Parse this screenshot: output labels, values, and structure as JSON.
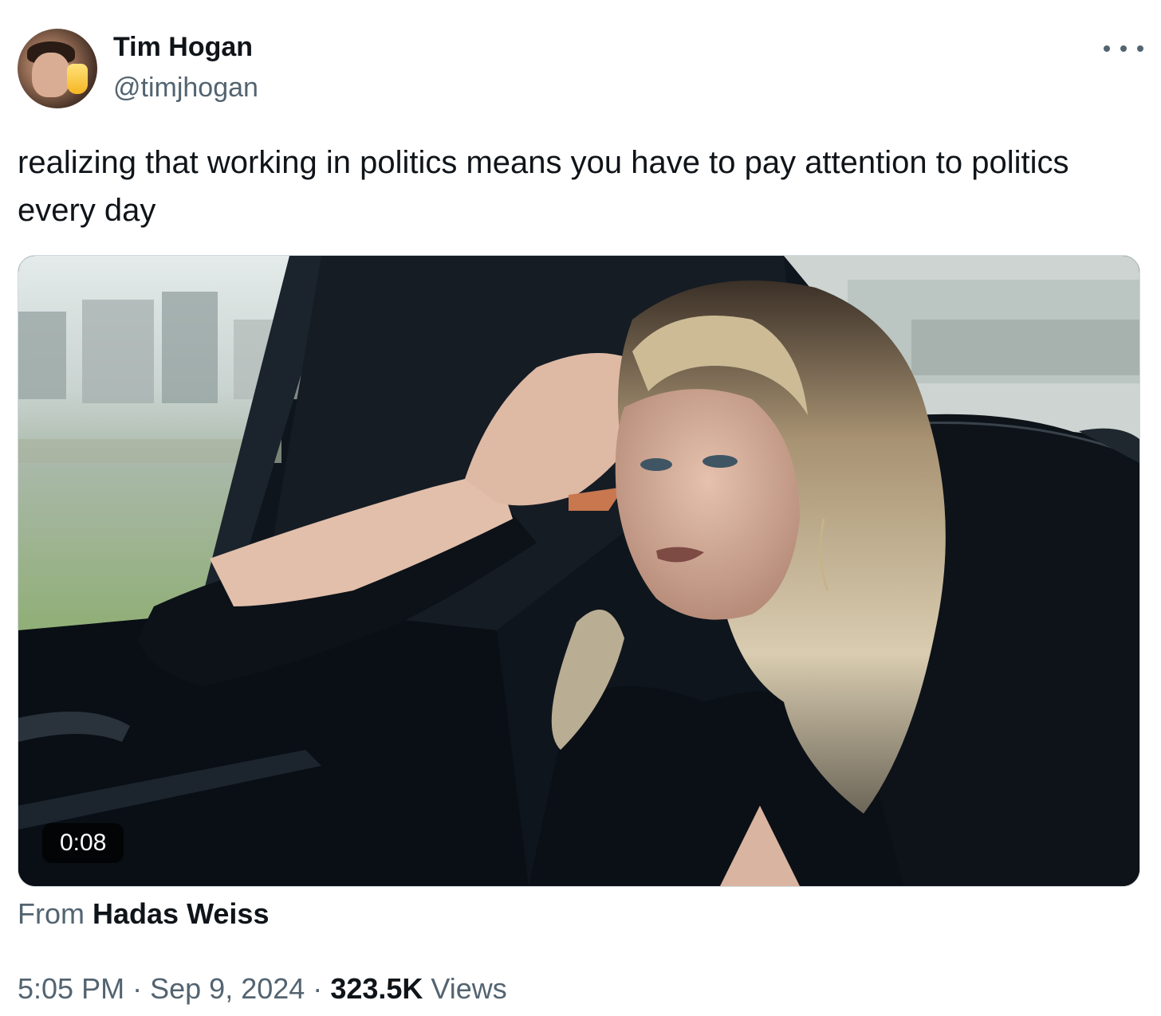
{
  "author": {
    "name": "Tim Hogan",
    "handle": "@timjhogan"
  },
  "tweet": {
    "text": "realizing that working in politics means you have to pay attention to politics every day"
  },
  "media": {
    "duration": "0:08"
  },
  "attribution": {
    "prefix": "From",
    "source": "Hadas Weiss"
  },
  "meta": {
    "time": "5:05 PM",
    "separator": "·",
    "date": "Sep 9, 2024",
    "views_count": "323.5K",
    "views_label": "Views"
  },
  "icons": {
    "more": "more-horizontal-icon"
  }
}
